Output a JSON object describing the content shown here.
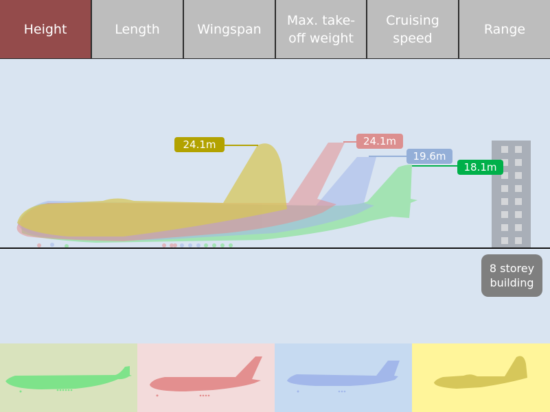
{
  "tabs": [
    {
      "label": "Height",
      "active": true
    },
    {
      "label": "Length",
      "active": false
    },
    {
      "label": "Wingspan",
      "active": false
    },
    {
      "label": "Max. take-off weight",
      "active": false
    },
    {
      "label": "Cruising speed",
      "active": false
    },
    {
      "label": "Range",
      "active": false
    }
  ],
  "aircraft": [
    {
      "name": "green-aircraft",
      "height_label": "18.1m",
      "color": "#7ee38a",
      "label_color": "#00b04a",
      "thumb_bg": "#d9e3bd"
    },
    {
      "name": "red-aircraft",
      "height_label": "24.1m",
      "color": "#e38f8f",
      "label_color": "#dc8f8f",
      "thumb_bg": "#f3dbdb"
    },
    {
      "name": "blue-aircraft",
      "height_label": "19.6m",
      "color": "#a2b7ea",
      "label_color": "#94afd8",
      "thumb_bg": "#c6daf1"
    },
    {
      "name": "yellow-aircraft",
      "height_label": "24.1m",
      "color": "#d6c75a",
      "label_color": "#b2a200",
      "thumb_bg": "#fff59a"
    }
  ],
  "building": {
    "label": "8 storey building",
    "storeys": 8
  },
  "colors": {
    "active_tab": "#944b4b",
    "inactive_tab": "#bdbdbd",
    "background": "#d9e4f1"
  }
}
